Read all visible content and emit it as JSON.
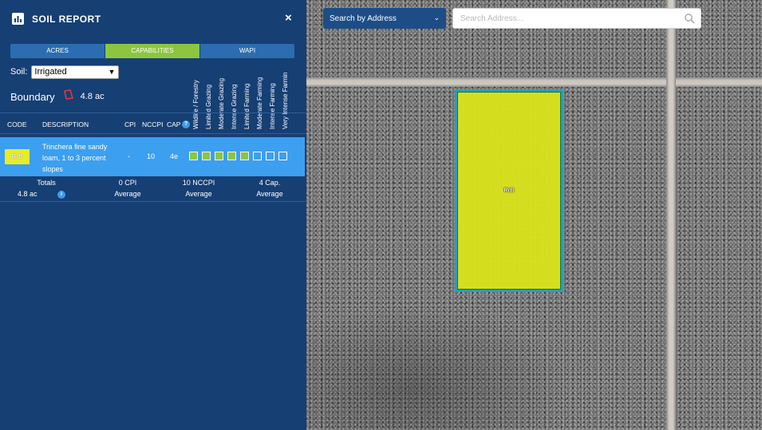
{
  "map": {
    "search_mode_label": "Search by Address",
    "search_placeholder": "Search Address...",
    "parcel_label": "RrB",
    "colors": {
      "parcel_fill": "#d9e21c",
      "parcel_border": "#1aa3c9"
    }
  },
  "panel": {
    "title": "SOIL REPORT",
    "close_glyph": "×",
    "tabs": [
      {
        "label": "ACRES",
        "active": false
      },
      {
        "label": "CAPABILITIES",
        "active": true
      },
      {
        "label": "WAPI",
        "active": false
      }
    ],
    "soil_label": "Soil:",
    "soil_value": "Irrigated",
    "boundary_label": "Boundary",
    "boundary_area": "4.8 ac",
    "capability_headers": [
      "Wildlife / Forestry",
      "Limited Grazing",
      "Moderate Grazing",
      "Intense Grazing",
      "Limited Farming",
      "Moderate Farming",
      "Intense Farming",
      "Very Intense Farmin"
    ],
    "columns": {
      "code": "CODE",
      "description": "DESCRIPTION",
      "cpi": "CPI",
      "nccpi": "NCCPI",
      "cap": "CAP",
      "help": "?"
    },
    "row": {
      "code": "RrB",
      "description": "Trinchera fine sandy loam, 1 to 3 percent slopes",
      "cpi": "-",
      "nccpi": "10",
      "cap": "4e",
      "capabilities_filled": 5,
      "capabilities_total": 8
    },
    "totals": {
      "label": "Totals",
      "area": "4.8 ac",
      "help": "i",
      "cpi_value": "0 CPI",
      "cpi_sub": "Average",
      "nccpi_value": "10 NCCPI",
      "nccpi_sub": "Average",
      "cap_value": "4 Cap.",
      "cap_sub": "Average"
    },
    "colors": {
      "panel_bg": "#163f74",
      "tab_active": "#8cc63f",
      "row_highlight": "#3c9ff0"
    }
  }
}
